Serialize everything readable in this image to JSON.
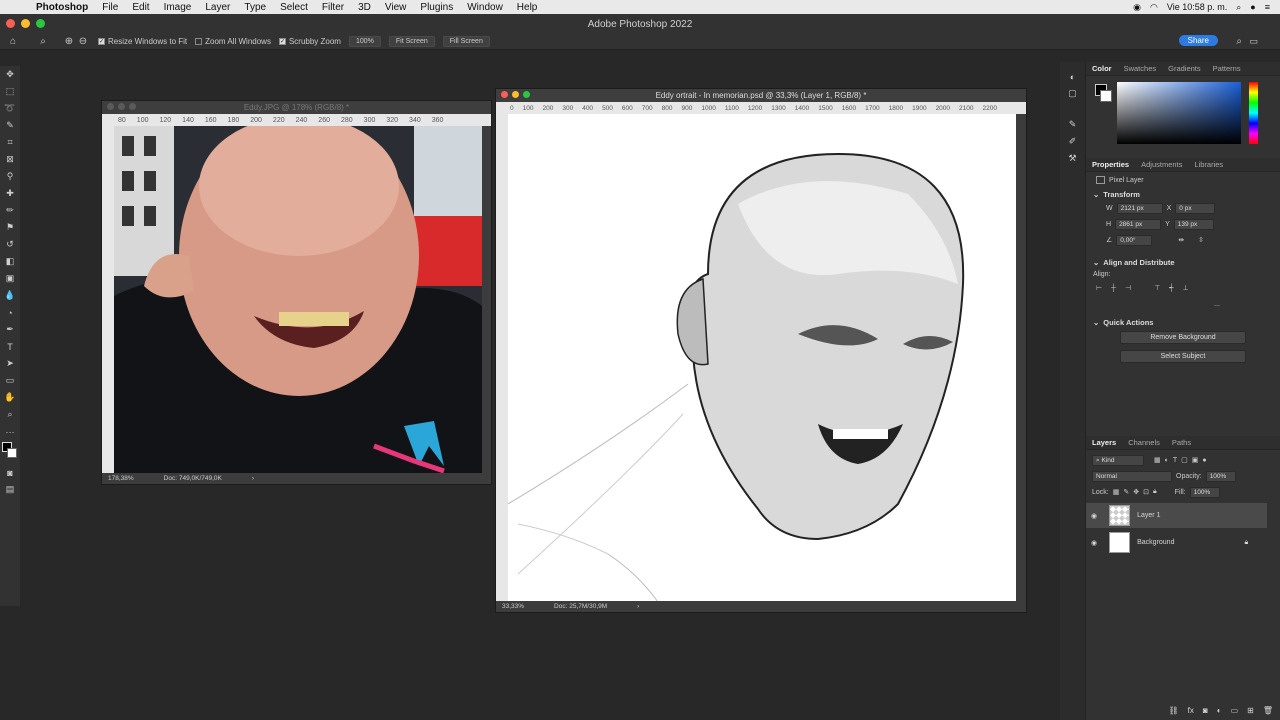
{
  "menubar": {
    "app": "Photoshop",
    "items": [
      "File",
      "Edit",
      "Image",
      "Layer",
      "Type",
      "Select",
      "Filter",
      "3D",
      "View",
      "Plugins",
      "Window",
      "Help"
    ],
    "clock": "Vie 10:58 p. m."
  },
  "window_title": "Adobe Photoshop 2022",
  "options_bar": {
    "resize_windows": "Resize Windows to Fit",
    "zoom_all": "Zoom All Windows",
    "scrubby_zoom": "Scrubby Zoom",
    "pct_button": "100%",
    "fit_screen": "Fit Screen",
    "fill_screen": "Fill Screen",
    "share": "Share"
  },
  "doc1": {
    "title": "Eddy.JPG @ 178% (RGB/8) *",
    "ruler": [
      "80",
      "100",
      "120",
      "140",
      "160",
      "180",
      "200",
      "220",
      "240",
      "260",
      "280",
      "300",
      "320",
      "340",
      "360"
    ],
    "zoom": "178,38%",
    "doc_size": "Doc: 749,0K/749,0K"
  },
  "doc2": {
    "title": "Eddy ortrait - In memorian.psd @ 33,3% (Layer 1, RGB/8) *",
    "ruler": [
      "0",
      "100",
      "200",
      "300",
      "400",
      "500",
      "600",
      "700",
      "800",
      "900",
      "1000",
      "1100",
      "1200",
      "1300",
      "1400",
      "1500",
      "1600",
      "1700",
      "1800",
      "1900",
      "2000",
      "2100",
      "2200"
    ],
    "zoom": "33,33%",
    "doc_size": "Doc: 25,7M/30,9M"
  },
  "color_panel": {
    "tabs": [
      "Color",
      "Swatches",
      "Gradients",
      "Patterns"
    ]
  },
  "properties": {
    "tabs": [
      "Properties",
      "Adjustments",
      "Libraries"
    ],
    "type": "Pixel Layer",
    "transform": "Transform",
    "w_label": "W",
    "w": "2121 px",
    "h_label": "H",
    "h": "2861 px",
    "x_label": "X",
    "x": "0 px",
    "y_label": "Y",
    "y": "139 px",
    "angle": "0,00°",
    "align": "Align and Distribute",
    "align_label": "Align:",
    "more": "...",
    "quick_actions": "Quick Actions",
    "remove_bg": "Remove Background",
    "select_subject": "Select Subject"
  },
  "layers": {
    "tabs": [
      "Layers",
      "Channels",
      "Paths"
    ],
    "kind": "Kind",
    "blend": "Normal",
    "opacity_label": "Opacity:",
    "opacity": "100%",
    "lock_label": "Lock:",
    "fill_label": "Fill:",
    "fill": "100%",
    "items": [
      {
        "name": "Layer 1"
      },
      {
        "name": "Background"
      }
    ]
  }
}
